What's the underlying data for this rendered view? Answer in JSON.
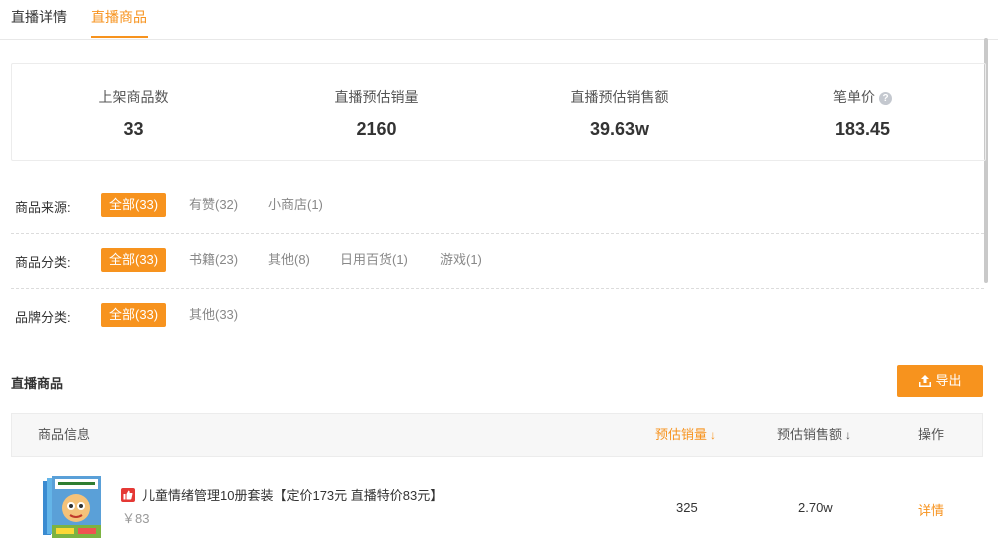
{
  "tabs": [
    {
      "label": "直播详情"
    },
    {
      "label": "直播商品"
    }
  ],
  "stats": [
    {
      "label": "上架商品数",
      "value": "33"
    },
    {
      "label": "直播预估销量",
      "value": "2160"
    },
    {
      "label": "直播预估销售额",
      "value": "39.63w"
    },
    {
      "label": "笔单价",
      "value": "183.45",
      "help_icon": "?"
    }
  ],
  "filters": {
    "source": {
      "label": "商品来源:",
      "options": [
        "全部(33)",
        "有赞(32)",
        "小商店(1)"
      ],
      "selected": "全部(33)"
    },
    "category": {
      "label": "商品分类:",
      "options": [
        "全部(33)",
        "书籍(23)",
        "其他(8)",
        "日用百货(1)",
        "游戏(1)"
      ],
      "selected": "全部(33)"
    },
    "brand": {
      "label": "品牌分类:",
      "options": [
        "全部(33)",
        "其他(33)"
      ],
      "selected": "全部(33)"
    }
  },
  "products_section": {
    "title": "直播商品",
    "export_label": "导出"
  },
  "table": {
    "headers": {
      "info": "商品信息",
      "est_sales": "预估销量",
      "est_revenue": "预估销售额",
      "action": "操作"
    },
    "sort_icon": "↓",
    "rows": [
      {
        "title": "儿童情绪管理10册套装【定价173元 直播特价83元】",
        "price": "￥83",
        "est_sales": "325",
        "est_revenue": "2.70w",
        "action": "详情"
      }
    ]
  },
  "colors": {
    "accent": "#f7931e",
    "badge": "#e53935"
  }
}
